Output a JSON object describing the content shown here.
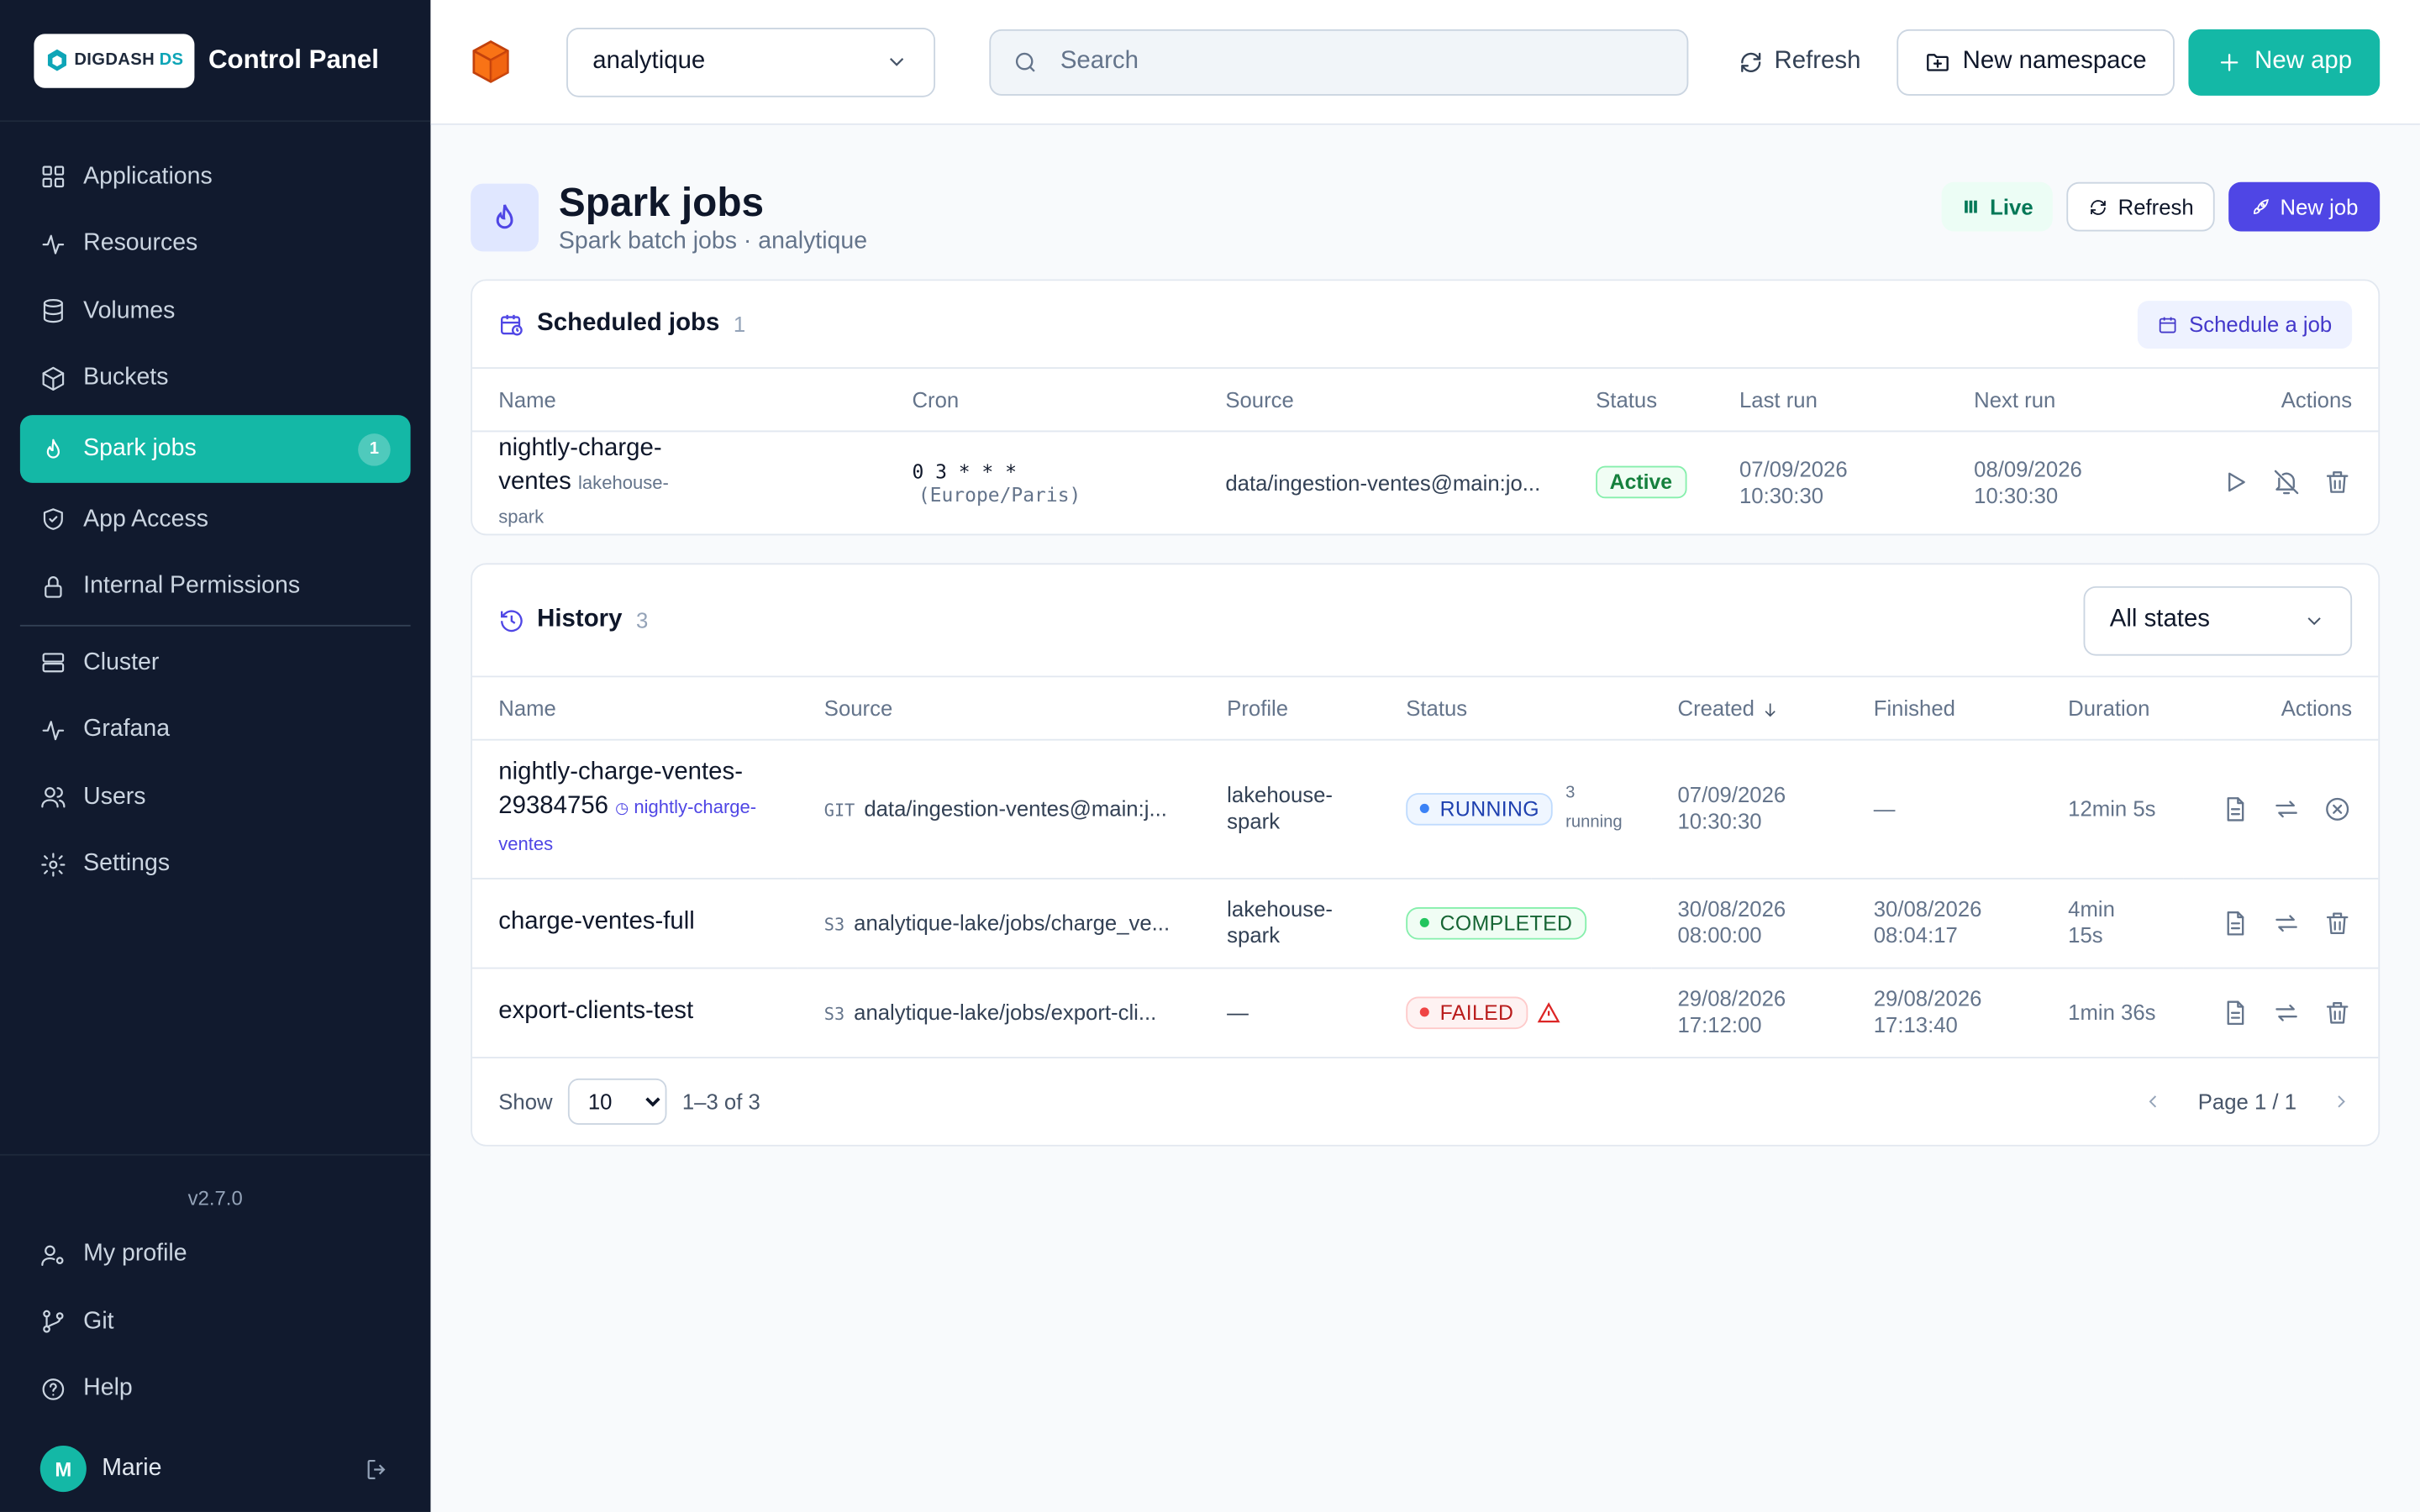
{
  "brand": {
    "logo_text": "DIGDASH",
    "logo_suffix": "DS",
    "title": "Control Panel"
  },
  "nav": {
    "items": [
      {
        "label": "Applications",
        "icon": "grid-icon"
      },
      {
        "label": "Resources",
        "icon": "activity-icon"
      },
      {
        "label": "Volumes",
        "icon": "database-icon"
      },
      {
        "label": "Buckets",
        "icon": "box-icon"
      },
      {
        "label": "Spark jobs",
        "icon": "flame-icon",
        "badge": "1",
        "active": true
      },
      {
        "label": "App Access",
        "icon": "shield-icon"
      },
      {
        "label": "Internal Permissions",
        "icon": "lock-icon"
      }
    ],
    "items2": [
      {
        "label": "Cluster",
        "icon": "server-icon"
      },
      {
        "label": "Grafana",
        "icon": "activity-icon"
      },
      {
        "label": "Users",
        "icon": "users-icon"
      },
      {
        "label": "Settings",
        "icon": "gear-icon"
      }
    ]
  },
  "sidebar_bottom": {
    "version": "v2.7.0",
    "my_profile": "My profile",
    "git": "Git",
    "help": "Help",
    "user_initial": "M",
    "user_name": "Marie"
  },
  "topbar": {
    "namespace": "analytique",
    "search_placeholder": "Search",
    "refresh": "Refresh",
    "new_namespace": "New namespace",
    "new_app": "New app"
  },
  "page": {
    "title": "Spark jobs",
    "subtitle": "Spark batch jobs · analytique",
    "live": "Live",
    "refresh": "Refresh",
    "new_job": "New job"
  },
  "scheduled": {
    "title": "Scheduled jobs",
    "count": "1",
    "schedule_button": "Schedule a job",
    "columns": [
      "Name",
      "Cron",
      "Source",
      "Status",
      "Last run",
      "Next run",
      "Actions"
    ],
    "rows": [
      {
        "name": "nightly-charge-ventes",
        "profile": "lakehouse-spark",
        "cron": "0 3 * * *",
        "timezone": "(Europe/Paris)",
        "source": "data/ingestion-ventes@main:jo...",
        "status": "Active",
        "last_run_date": "07/09/2026",
        "last_run_time": "10:30:30",
        "next_run_date": "08/09/2026",
        "next_run_time": "10:30:30"
      }
    ]
  },
  "history": {
    "title": "History",
    "count": "3",
    "filter": "All states",
    "columns": [
      "Name",
      "Source",
      "Profile",
      "Status",
      "Created",
      "Finished",
      "Duration",
      "Actions"
    ],
    "rows": [
      {
        "name_line1": "nightly-charge-ventes-",
        "name_line2": "29384756",
        "schedule_link": "nightly-charge-ventes",
        "source_type": "GIT",
        "source": "data/ingestion-ventes@main:j...",
        "profile": "lakehouse-spark",
        "status": "RUNNING",
        "running_count": "3",
        "running_label": "running",
        "created_date": "07/09/2026",
        "created_time": "10:30:30",
        "finished": "—",
        "duration": "12min 5s"
      },
      {
        "name_line1": "charge-ventes-full",
        "source_type": "S3",
        "source": "analytique-lake/jobs/charge_ve...",
        "profile": "lakehouse-spark",
        "status": "COMPLETED",
        "created_date": "30/08/2026",
        "created_time": "08:00:00",
        "finished_date": "30/08/2026",
        "finished_time": "08:04:17",
        "duration": "4min 15s"
      },
      {
        "name_line1": "export-clients-test",
        "source_type": "S3",
        "source": "analytique-lake/jobs/export-cli...",
        "profile": "—",
        "status": "FAILED",
        "created_date": "29/08/2026",
        "created_time": "17:12:00",
        "finished_date": "29/08/2026",
        "finished_time": "17:13:40",
        "duration": "1min 36s"
      }
    ],
    "footer": {
      "show": "Show",
      "page_size": "10",
      "range": "1–3 of 3",
      "page": "Page 1 / 1"
    }
  },
  "colors": {
    "sidebar_bg": "#111a2e",
    "accent_teal": "#14b8a6",
    "accent_indigo": "#4f46e5"
  }
}
